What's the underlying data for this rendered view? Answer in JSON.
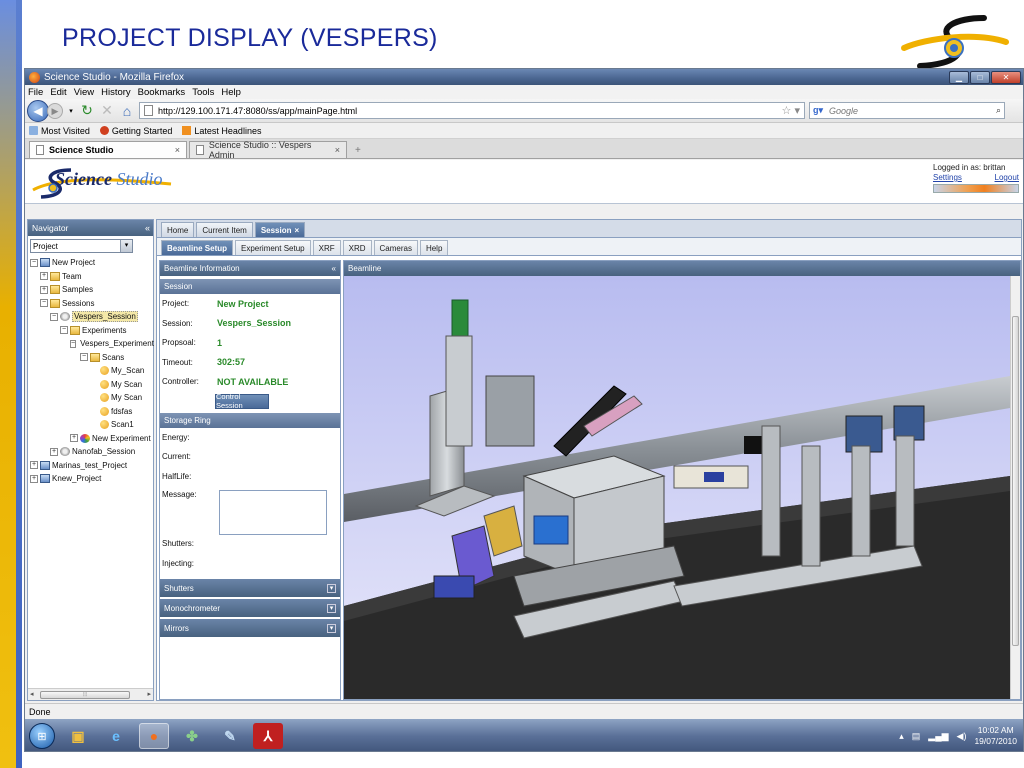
{
  "slide": {
    "title": "PROJECT DISPLAY (VESPERS)"
  },
  "browser": {
    "window_title": "Science Studio - Mozilla Firefox",
    "menu": [
      "File",
      "Edit",
      "View",
      "History",
      "Bookmarks",
      "Tools",
      "Help"
    ],
    "url": "http://129.100.171.47:8080/ss/app/mainPage.html",
    "search_placeholder": "Google",
    "bookmarks": [
      "Most Visited",
      "Getting Started",
      "Latest Headlines"
    ],
    "tabs": [
      {
        "label": "Science Studio",
        "close": "×"
      },
      {
        "label": "Science Studio :: Vespers Admin",
        "close": "×"
      }
    ],
    "new_tab": "+",
    "status": "Done"
  },
  "app": {
    "logo_text_a": "Science",
    "logo_text_b": "Studio",
    "logged_in": "Logged in as: brittan",
    "settings": "Settings",
    "logout": "Logout"
  },
  "navigator": {
    "title": "Navigator",
    "select_value": "Project",
    "tree": [
      {
        "label": "New Project",
        "level": 0,
        "icon": "proj",
        "exp": "−"
      },
      {
        "label": "Team",
        "level": 1,
        "icon": "folder",
        "exp": "+"
      },
      {
        "label": "Samples",
        "level": 1,
        "icon": "folder",
        "exp": "+"
      },
      {
        "label": "Sessions",
        "level": 1,
        "icon": "folder",
        "exp": "−"
      },
      {
        "label": "Vespers_Session",
        "level": 2,
        "icon": "sess",
        "exp": "−",
        "selected": true
      },
      {
        "label": "Experiments",
        "level": 3,
        "icon": "folder",
        "exp": "−"
      },
      {
        "label": "Vespers_Experiment",
        "level": 4,
        "icon": "exp-ball",
        "exp": "−"
      },
      {
        "label": "Scans",
        "level": 5,
        "icon": "folder",
        "exp": "−"
      },
      {
        "label": "My_Scan",
        "level": 6,
        "icon": "scan",
        "exp": ""
      },
      {
        "label": "My Scan",
        "level": 6,
        "icon": "scan",
        "exp": ""
      },
      {
        "label": "My Scan",
        "level": 6,
        "icon": "scan",
        "exp": ""
      },
      {
        "label": "fdsfas",
        "level": 6,
        "icon": "scan",
        "exp": ""
      },
      {
        "label": "Scan1",
        "level": 6,
        "icon": "scan",
        "exp": ""
      },
      {
        "label": "New Experiment",
        "level": 4,
        "icon": "exp-ball",
        "exp": "+"
      },
      {
        "label": "Nanofab_Session",
        "level": 2,
        "icon": "sess",
        "exp": "+"
      },
      {
        "label": "Marinas_test_Project",
        "level": 0,
        "icon": "proj",
        "exp": "+"
      },
      {
        "label": "Knew_Project",
        "level": 0,
        "icon": "proj",
        "exp": "+"
      }
    ]
  },
  "main": {
    "top_tabs": [
      "Home",
      "Current Item",
      "Session"
    ],
    "sub_tabs": [
      "Beamline Setup",
      "Experiment Setup",
      "XRF",
      "XRD",
      "Cameras",
      "Help"
    ],
    "beamline_info_title": "Beamline Information",
    "session_head": "Session",
    "session_fields": [
      {
        "k": "Project:",
        "v": "New Project"
      },
      {
        "k": "Session:",
        "v": "Vespers_Session"
      },
      {
        "k": "Propsoal:",
        "v": "1"
      },
      {
        "k": "Timeout:",
        "v": "302:57"
      },
      {
        "k": "Controller:",
        "v": "NOT AVAILABLE"
      }
    ],
    "control_button": "Control Session",
    "storage_head": "Storage Ring",
    "storage_fields": [
      "Energy:",
      "Current:",
      "HalfLife:",
      "Message:",
      "Shutters:",
      "Injecting:"
    ],
    "collapsed_sections": [
      "Shutters",
      "Monochrometer",
      "Mirrors"
    ],
    "beamline_title": "Beamline"
  },
  "taskbar": {
    "time": "10:02 AM",
    "date": "19/07/2010"
  },
  "colors": {
    "slide_title": "#1a2a9a",
    "panel_header": "#48627f",
    "value_green": "#2a8a2a"
  }
}
